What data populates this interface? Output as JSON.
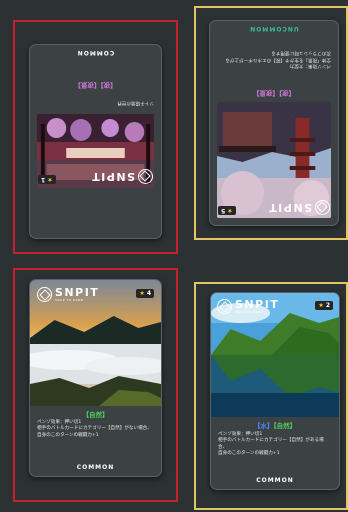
{
  "cards": [
    {
      "rarity": "COMMON",
      "title_strip": "ソトチ環境の世界",
      "tags": "【夜】【夜景】",
      "brand": "SNPIT",
      "star_level": "1"
    },
    {
      "rarity": "UNCOMMON",
      "effect_lines": [
        "ペンゾ効果：大型力",
        "全体「夜景」を生かす【夜】のエネルギーが上がる",
        "次のフラッシュ時に使用する"
      ],
      "tags": "【夜】【夜景】",
      "brand": "SNPIT",
      "star_level": "5"
    },
    {
      "rarity": "COMMON",
      "brand": "SNPIT",
      "brand_sub": "SNAP TO EARN",
      "star_level": "4",
      "tags": "【自然】",
      "effect_lines": [
        "ペンゾ効果：押い切1",
        "相手のバトルカードにカテゴリー【自然】がない場合、",
        "自身のこのターンの戦闘力+1"
      ]
    },
    {
      "rarity": "COMMON",
      "brand": "SNPIT",
      "brand_sub": "SNAP TO EARN",
      "star_level": "2",
      "tags_part1": "【水】",
      "tags_part2": "【自然】",
      "effect_lines": [
        "ペンゾ効果：押い切1",
        "相手のバトルカードにカテゴリー【自然】がある場合、",
        "自身のこのターンの戦闘力+1"
      ]
    }
  ],
  "colors": {
    "background": "#2c3133",
    "frame_red": "#c8202a",
    "frame_yellow": "#e3c563",
    "uncommon_text": "#3fb99c",
    "tag_purple": "#c876d4",
    "tag_blue": "#4f86ff",
    "tag_green": "#4ecf58"
  },
  "icons": [
    "snpit-logo-icon",
    "star-icon"
  ]
}
